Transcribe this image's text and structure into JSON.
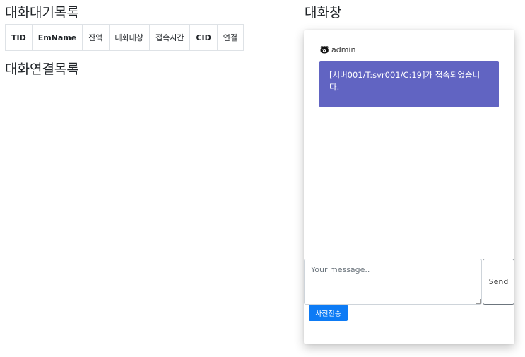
{
  "waiting_list": {
    "title": "대화대기목록",
    "columns": [
      "TID",
      "EmName",
      "잔액",
      "대화대상",
      "접속시간",
      "CID",
      "연결"
    ],
    "rows": []
  },
  "connected_list": {
    "title": "대화연결목록"
  },
  "chat": {
    "title": "대화창",
    "messages": [
      {
        "sender": "admin",
        "sender_icon": "admin-icon",
        "text": "[서버001/T:svr001/C:19]가 접속되었습니다."
      }
    ],
    "input": {
      "placeholder": "Your message..",
      "value": ""
    },
    "send_label": "Send",
    "photo_label": "사진전송",
    "accent_color": "#6164c2",
    "button_color": "#0d7bf5"
  }
}
